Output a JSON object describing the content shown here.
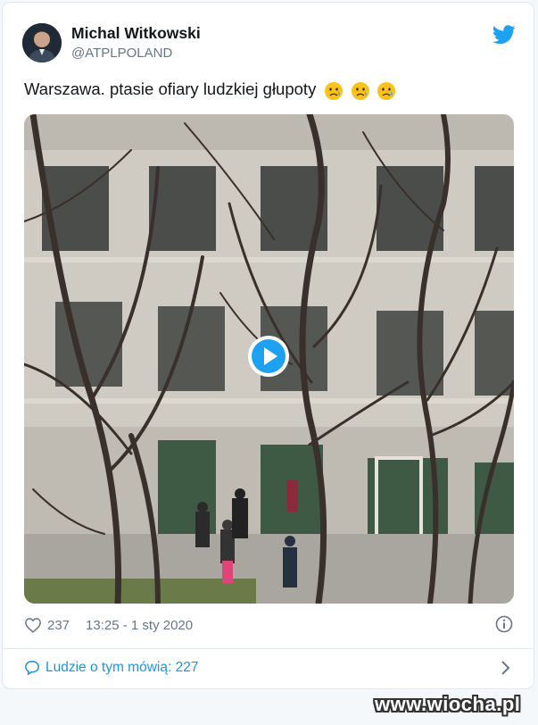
{
  "tweet": {
    "author_name": "Michal Witkowski",
    "author_handle": "@ATPLPOLAND",
    "text": "Warszawa. ptasie ofiary ludzkiej głupoty",
    "emojis": [
      "crying-face-emoji",
      "crying-face-emoji",
      "crying-face-emoji"
    ],
    "likes": "237",
    "timestamp": "13:25 - 1 sty 2020",
    "talk_label": "Ludzie o tym mówią: 227"
  },
  "icons": {
    "brand": "twitter-bird-icon",
    "play": "play-icon",
    "like": "heart-icon",
    "info": "info-icon",
    "talk": "speech-bubble-icon",
    "next": "chevron-right-icon"
  },
  "watermark": "www.wiocha.pl",
  "colors": {
    "accent": "#1da1f2",
    "link": "#1b95e0",
    "secondary_text": "#657786",
    "primary_text": "#14171a",
    "border": "#e1e8ed"
  }
}
